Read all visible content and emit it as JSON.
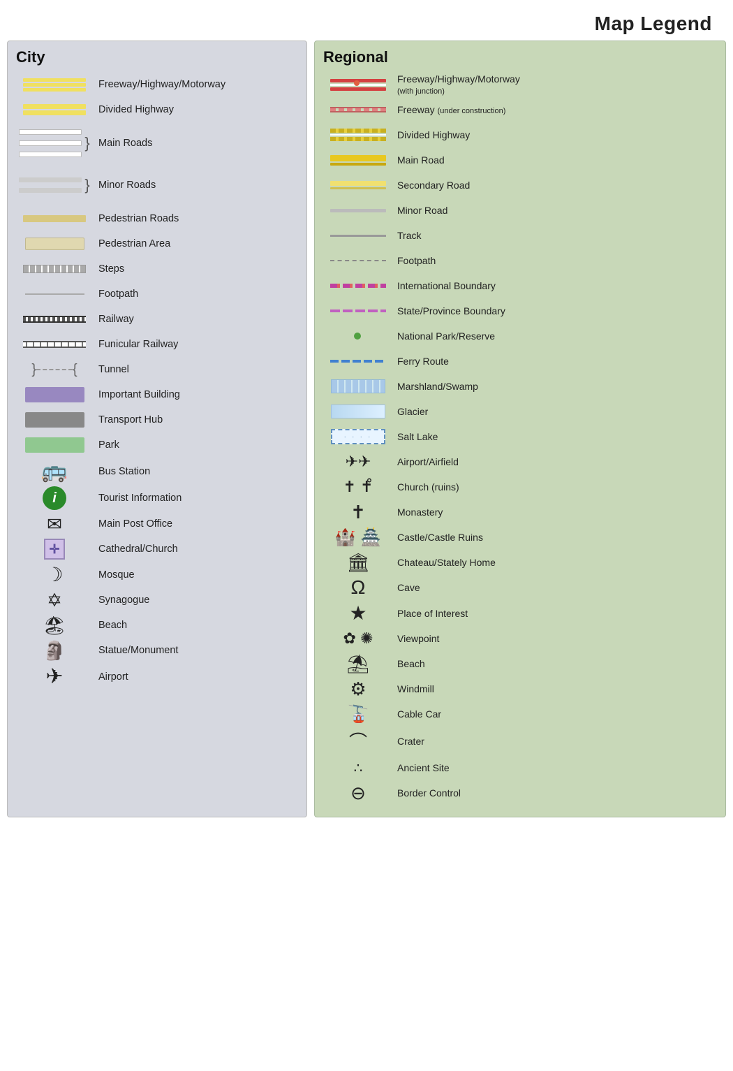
{
  "page": {
    "title": "Map Legend"
  },
  "city": {
    "title": "City",
    "items": [
      {
        "label": "Freeway/Highway/Motorway",
        "symbol": "freeway"
      },
      {
        "label": "Divided Highway",
        "symbol": "divided-highway"
      },
      {
        "label": "Main Roads",
        "symbol": "main-roads"
      },
      {
        "label": "Minor Roads",
        "symbol": "minor-roads"
      },
      {
        "label": "Pedestrian Roads",
        "symbol": "pedestrian-roads"
      },
      {
        "label": "Pedestrian Area",
        "symbol": "pedestrian-area"
      },
      {
        "label": "Steps",
        "symbol": "steps"
      },
      {
        "label": "Footpath",
        "symbol": "footpath"
      },
      {
        "label": "Railway",
        "symbol": "railway"
      },
      {
        "label": "Funicular Railway",
        "symbol": "funicular"
      },
      {
        "label": "Tunnel",
        "symbol": "tunnel"
      },
      {
        "label": "Important Building",
        "symbol": "important-building"
      },
      {
        "label": "Transport Hub",
        "symbol": "transport-hub"
      },
      {
        "label": "Park",
        "symbol": "park"
      },
      {
        "label": "Bus Station",
        "symbol": "bus-station"
      },
      {
        "label": "Tourist Information",
        "symbol": "tourist-info"
      },
      {
        "label": "Main Post Office",
        "symbol": "post-office"
      },
      {
        "label": "Cathedral/Church",
        "symbol": "cathedral"
      },
      {
        "label": "Mosque",
        "symbol": "mosque"
      },
      {
        "label": "Synagogue",
        "symbol": "synagogue"
      },
      {
        "label": "Beach",
        "symbol": "beach"
      },
      {
        "label": "Statue/Monument",
        "symbol": "statue"
      },
      {
        "label": "Airport",
        "symbol": "airport"
      }
    ]
  },
  "regional": {
    "title": "Regional",
    "items": [
      {
        "label": "Freeway/Highway/Motorway",
        "sublabel": "(with junction)",
        "symbol": "reg-freeway"
      },
      {
        "label": "Freeway",
        "sublabel": "(under construction)",
        "symbol": "reg-freeway-construction"
      },
      {
        "label": "Divided Highway",
        "symbol": "reg-divided"
      },
      {
        "label": "Main Road",
        "symbol": "reg-main"
      },
      {
        "label": "Secondary Road",
        "symbol": "reg-secondary"
      },
      {
        "label": "Minor Road",
        "symbol": "reg-minor"
      },
      {
        "label": "Track",
        "symbol": "reg-track"
      },
      {
        "label": "Footpath",
        "symbol": "reg-footpath"
      },
      {
        "label": "International Boundary",
        "symbol": "intl-boundary"
      },
      {
        "label": "State/Province Boundary",
        "symbol": "state-boundary"
      },
      {
        "label": "National Park/Reserve",
        "symbol": "nat-park"
      },
      {
        "label": "Ferry Route",
        "symbol": "ferry"
      },
      {
        "label": "Marshland/Swamp",
        "symbol": "marsh"
      },
      {
        "label": "Glacier",
        "symbol": "glacier"
      },
      {
        "label": "Salt Lake",
        "symbol": "salt-lake"
      },
      {
        "label": "Airport/Airfield",
        "symbol": "airports"
      },
      {
        "label": "Church (ruins)",
        "symbol": "church-ruins"
      },
      {
        "label": "Monastery",
        "symbol": "monastery"
      },
      {
        "label": "Castle/Castle Ruins",
        "symbol": "castle"
      },
      {
        "label": "Chateau/Stately Home",
        "symbol": "chateau"
      },
      {
        "label": "Cave",
        "symbol": "cave"
      },
      {
        "label": "Place of Interest",
        "symbol": "place-interest"
      },
      {
        "label": "Viewpoint",
        "symbol": "viewpoint"
      },
      {
        "label": "Beach",
        "symbol": "reg-beach"
      },
      {
        "label": "Windmill",
        "symbol": "windmill"
      },
      {
        "label": "Cable Car",
        "symbol": "cable-car"
      },
      {
        "label": "Crater",
        "symbol": "crater"
      },
      {
        "label": "Ancient Site",
        "symbol": "ancient-site"
      },
      {
        "label": "Border Control",
        "symbol": "border-control"
      }
    ]
  }
}
